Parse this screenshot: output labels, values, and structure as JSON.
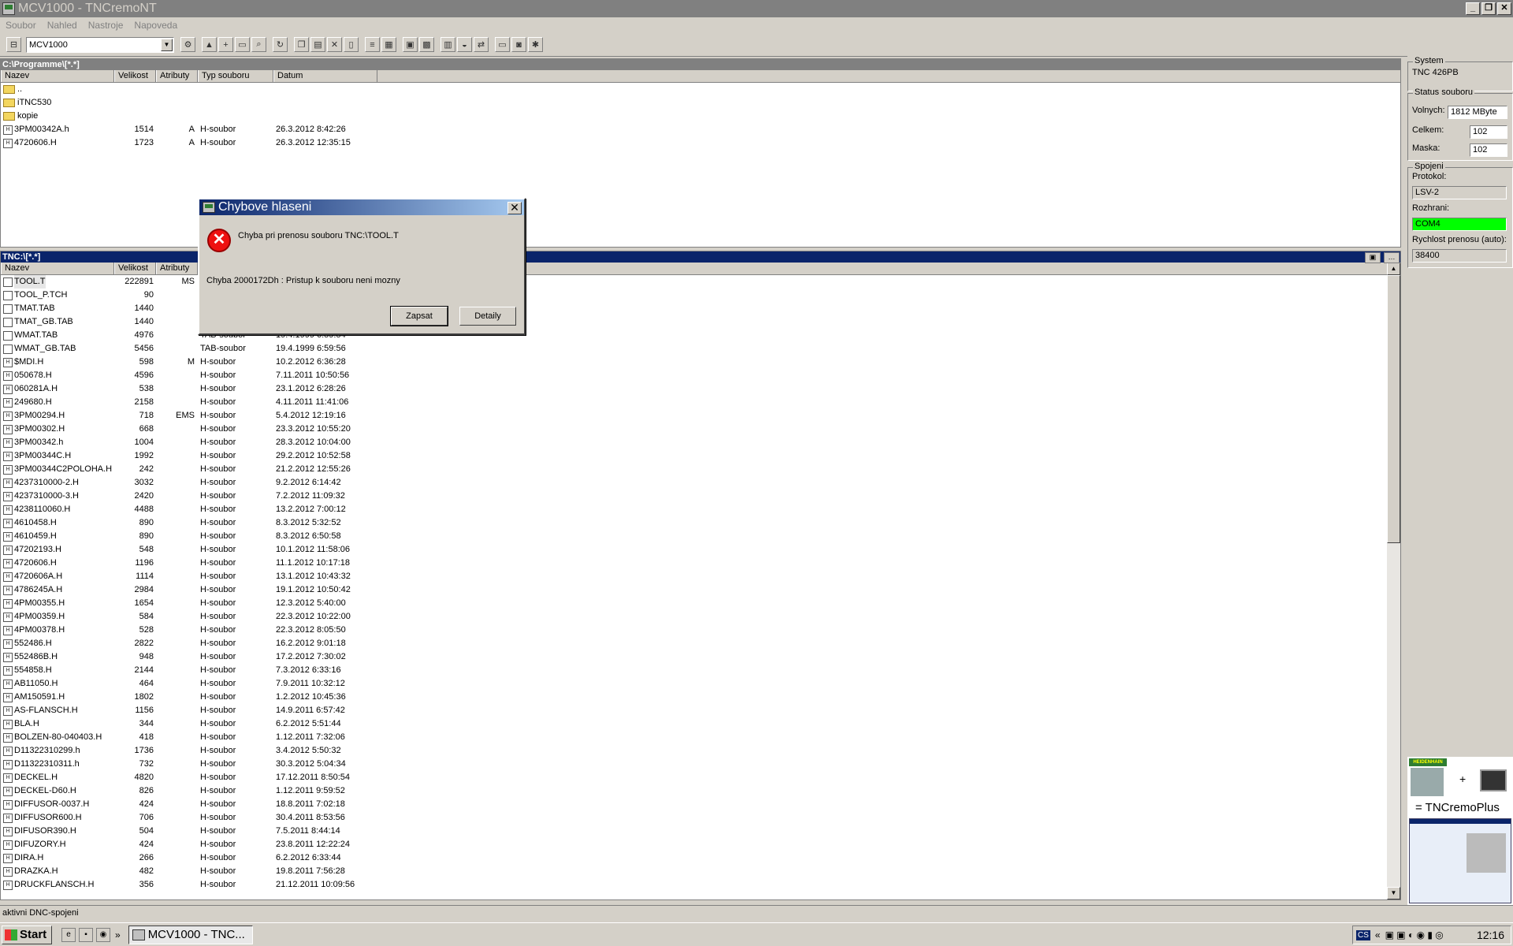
{
  "window": {
    "title": "MCV1000 - TNCremoNT"
  },
  "menu": [
    "Soubor",
    "Nahled",
    "Nastroje",
    "Napoveda"
  ],
  "toolbar": {
    "connection_combo": "MCV1000"
  },
  "columns": {
    "name": "Nazev",
    "size": "Velikost",
    "attr": "Atributy",
    "type": "Typ souboru",
    "date": "Datum"
  },
  "pc_panel": {
    "path": "C:\\Programme\\[*.*]",
    "rows": [
      {
        "name": "..",
        "size": "",
        "attr": "",
        "type": "",
        "date": "",
        "kind": "dir"
      },
      {
        "name": "iTNC530",
        "size": "",
        "attr": "",
        "type": "",
        "date": "",
        "kind": "dir"
      },
      {
        "name": "kopie",
        "size": "",
        "attr": "",
        "type": "",
        "date": "",
        "kind": "dir"
      },
      {
        "name": "3PM00342A.h",
        "size": "1514",
        "attr": "A",
        "type": "H-soubor",
        "date": "26.3.2012 8:42:26",
        "kind": "h"
      },
      {
        "name": "4720606.H",
        "size": "1723",
        "attr": "A",
        "type": "H-soubor",
        "date": "26.3.2012 12:35:15",
        "kind": "h"
      }
    ]
  },
  "tnc_panel": {
    "path": "TNC:\\[*.*]",
    "rows": [
      {
        "name": "TOOL.T",
        "size": "222891",
        "attr": "MS",
        "type": "",
        "date": "",
        "kind": "t"
      },
      {
        "name": "TOOL_P.TCH",
        "size": "90",
        "attr": "",
        "type": "",
        "date": "",
        "kind": "t"
      },
      {
        "name": "TMAT.TAB",
        "size": "1440",
        "attr": "",
        "type": "",
        "date": "",
        "kind": "t"
      },
      {
        "name": "TMAT_GB.TAB",
        "size": "1440",
        "attr": "",
        "type": "",
        "date": "",
        "kind": "t"
      },
      {
        "name": "WMAT.TAB",
        "size": "4976",
        "attr": "",
        "type": "TAB-soubor",
        "date": "19.4.1999 6:59:54",
        "kind": "t"
      },
      {
        "name": "WMAT_GB.TAB",
        "size": "5456",
        "attr": "",
        "type": "TAB-soubor",
        "date": "19.4.1999 6:59:56",
        "kind": "t"
      },
      {
        "name": "$MDI.H",
        "size": "598",
        "attr": "M",
        "type": "H-soubor",
        "date": "10.2.2012 6:36:28",
        "kind": "h"
      },
      {
        "name": "050678.H",
        "size": "4596",
        "attr": "",
        "type": "H-soubor",
        "date": "7.11.2011 10:50:56",
        "kind": "h"
      },
      {
        "name": "060281A.H",
        "size": "538",
        "attr": "",
        "type": "H-soubor",
        "date": "23.1.2012 6:28:26",
        "kind": "h"
      },
      {
        "name": "249680.H",
        "size": "2158",
        "attr": "",
        "type": "H-soubor",
        "date": "4.11.2011 11:41:06",
        "kind": "h"
      },
      {
        "name": "3PM00294.H",
        "size": "718",
        "attr": "EMS",
        "type": "H-soubor",
        "date": "5.4.2012 12:19:16",
        "kind": "h"
      },
      {
        "name": "3PM00302.H",
        "size": "668",
        "attr": "",
        "type": "H-soubor",
        "date": "23.3.2012 10:55:20",
        "kind": "h"
      },
      {
        "name": "3PM00342.h",
        "size": "1004",
        "attr": "",
        "type": "H-soubor",
        "date": "28.3.2012 10:04:00",
        "kind": "h"
      },
      {
        "name": "3PM00344C.H",
        "size": "1992",
        "attr": "",
        "type": "H-soubor",
        "date": "29.2.2012 10:52:58",
        "kind": "h"
      },
      {
        "name": "3PM00344C2POLOHA.H",
        "size": "242",
        "attr": "",
        "type": "H-soubor",
        "date": "21.2.2012 12:55:26",
        "kind": "h"
      },
      {
        "name": "4237310000-2.H",
        "size": "3032",
        "attr": "",
        "type": "H-soubor",
        "date": "9.2.2012 6:14:42",
        "kind": "h"
      },
      {
        "name": "4237310000-3.H",
        "size": "2420",
        "attr": "",
        "type": "H-soubor",
        "date": "7.2.2012 11:09:32",
        "kind": "h"
      },
      {
        "name": "4238110060.H",
        "size": "4488",
        "attr": "",
        "type": "H-soubor",
        "date": "13.2.2012 7:00:12",
        "kind": "h"
      },
      {
        "name": "4610458.H",
        "size": "890",
        "attr": "",
        "type": "H-soubor",
        "date": "8.3.2012 5:32:52",
        "kind": "h"
      },
      {
        "name": "4610459.H",
        "size": "890",
        "attr": "",
        "type": "H-soubor",
        "date": "8.3.2012 6:50:58",
        "kind": "h"
      },
      {
        "name": "47202193.H",
        "size": "548",
        "attr": "",
        "type": "H-soubor",
        "date": "10.1.2012 11:58:06",
        "kind": "h"
      },
      {
        "name": "4720606.H",
        "size": "1196",
        "attr": "",
        "type": "H-soubor",
        "date": "11.1.2012 10:17:18",
        "kind": "h"
      },
      {
        "name": "4720606A.H",
        "size": "1114",
        "attr": "",
        "type": "H-soubor",
        "date": "13.1.2012 10:43:32",
        "kind": "h"
      },
      {
        "name": "4786245A.H",
        "size": "2984",
        "attr": "",
        "type": "H-soubor",
        "date": "19.1.2012 10:50:42",
        "kind": "h"
      },
      {
        "name": "4PM00355.H",
        "size": "1654",
        "attr": "",
        "type": "H-soubor",
        "date": "12.3.2012 5:40:00",
        "kind": "h"
      },
      {
        "name": "4PM00359.H",
        "size": "584",
        "attr": "",
        "type": "H-soubor",
        "date": "22.3.2012 10:22:00",
        "kind": "h"
      },
      {
        "name": "4PM00378.H",
        "size": "528",
        "attr": "",
        "type": "H-soubor",
        "date": "22.3.2012 8:05:50",
        "kind": "h"
      },
      {
        "name": "552486.H",
        "size": "2822",
        "attr": "",
        "type": "H-soubor",
        "date": "16.2.2012 9:01:18",
        "kind": "h"
      },
      {
        "name": "552486B.H",
        "size": "948",
        "attr": "",
        "type": "H-soubor",
        "date": "17.2.2012 7:30:02",
        "kind": "h"
      },
      {
        "name": "554858.H",
        "size": "2144",
        "attr": "",
        "type": "H-soubor",
        "date": "7.3.2012 6:33:16",
        "kind": "h"
      },
      {
        "name": "AB11050.H",
        "size": "464",
        "attr": "",
        "type": "H-soubor",
        "date": "7.9.2011 10:32:12",
        "kind": "h"
      },
      {
        "name": "AM150591.H",
        "size": "1802",
        "attr": "",
        "type": "H-soubor",
        "date": "1.2.2012 10:45:36",
        "kind": "h"
      },
      {
        "name": "AS-FLANSCH.H",
        "size": "1156",
        "attr": "",
        "type": "H-soubor",
        "date": "14.9.2011 6:57:42",
        "kind": "h"
      },
      {
        "name": "BLA.H",
        "size": "344",
        "attr": "",
        "type": "H-soubor",
        "date": "6.2.2012 5:51:44",
        "kind": "h"
      },
      {
        "name": "BOLZEN-80-040403.H",
        "size": "418",
        "attr": "",
        "type": "H-soubor",
        "date": "1.12.2011 7:32:06",
        "kind": "h"
      },
      {
        "name": "D11322310299.h",
        "size": "1736",
        "attr": "",
        "type": "H-soubor",
        "date": "3.4.2012 5:50:32",
        "kind": "h"
      },
      {
        "name": "D11322310311.h",
        "size": "732",
        "attr": "",
        "type": "H-soubor",
        "date": "30.3.2012 5:04:34",
        "kind": "h"
      },
      {
        "name": "DECKEL.H",
        "size": "4820",
        "attr": "",
        "type": "H-soubor",
        "date": "17.12.2011 8:50:54",
        "kind": "h"
      },
      {
        "name": "DECKEL-D60.H",
        "size": "826",
        "attr": "",
        "type": "H-soubor",
        "date": "1.12.2011 9:59:52",
        "kind": "h"
      },
      {
        "name": "DIFFUSOR-0037.H",
        "size": "424",
        "attr": "",
        "type": "H-soubor",
        "date": "18.8.2011 7:02:18",
        "kind": "h"
      },
      {
        "name": "DIFFUSOR600.H",
        "size": "706",
        "attr": "",
        "type": "H-soubor",
        "date": "30.4.2011 8:53:56",
        "kind": "h"
      },
      {
        "name": "DIFUSOR390.H",
        "size": "504",
        "attr": "",
        "type": "H-soubor",
        "date": "7.5.2011 8:44:14",
        "kind": "h"
      },
      {
        "name": "DIFUZORY.H",
        "size": "424",
        "attr": "",
        "type": "H-soubor",
        "date": "23.8.2011 12:22:24",
        "kind": "h"
      },
      {
        "name": "DIRA.H",
        "size": "266",
        "attr": "",
        "type": "H-soubor",
        "date": "6.2.2012 6:33:44",
        "kind": "h"
      },
      {
        "name": "DRAZKA.H",
        "size": "482",
        "attr": "",
        "type": "H-soubor",
        "date": "19.8.2011 7:56:28",
        "kind": "h"
      },
      {
        "name": "DRUCKFLANSCH.H",
        "size": "356",
        "attr": "",
        "type": "H-soubor",
        "date": "21.12.2011 10:09:56",
        "kind": "h"
      }
    ]
  },
  "side": {
    "system_label": "System",
    "system_value": "TNC 426PB",
    "status_label": "Status souboru",
    "free_label": "Volnych:",
    "free_value": "1812 MByte",
    "total_label": "Celkem:",
    "total_value": "102",
    "mask_label": "Maska:",
    "mask_value": "102",
    "conn_label": "Spojeni",
    "protocol_label": "Protokol:",
    "protocol_value": "LSV-2",
    "iface_label": "Rozhrani:",
    "iface_value": "COM4",
    "speed_label": "Rychlost prenosu (auto):",
    "speed_value": "38400",
    "iface_color": "#00ff00",
    "ad_brand": "HEIDENHAIN",
    "ad_text": "= TNCremoPlus"
  },
  "dialog": {
    "title": "Chybove hlaseni",
    "message": "Chyba pri prenosu souboru TNC:\\TOOL.T",
    "detail": "Chyba 2000172Dh : Pristup k souboru neni mozny",
    "primary_button": "Zapsat",
    "secondary_button": "Detaily"
  },
  "status_text": "aktivni DNC-spojeni",
  "taskbar": {
    "start": "Start",
    "task": "MCV1000 - TNC...",
    "clock": "12:16",
    "lang": "CS"
  }
}
